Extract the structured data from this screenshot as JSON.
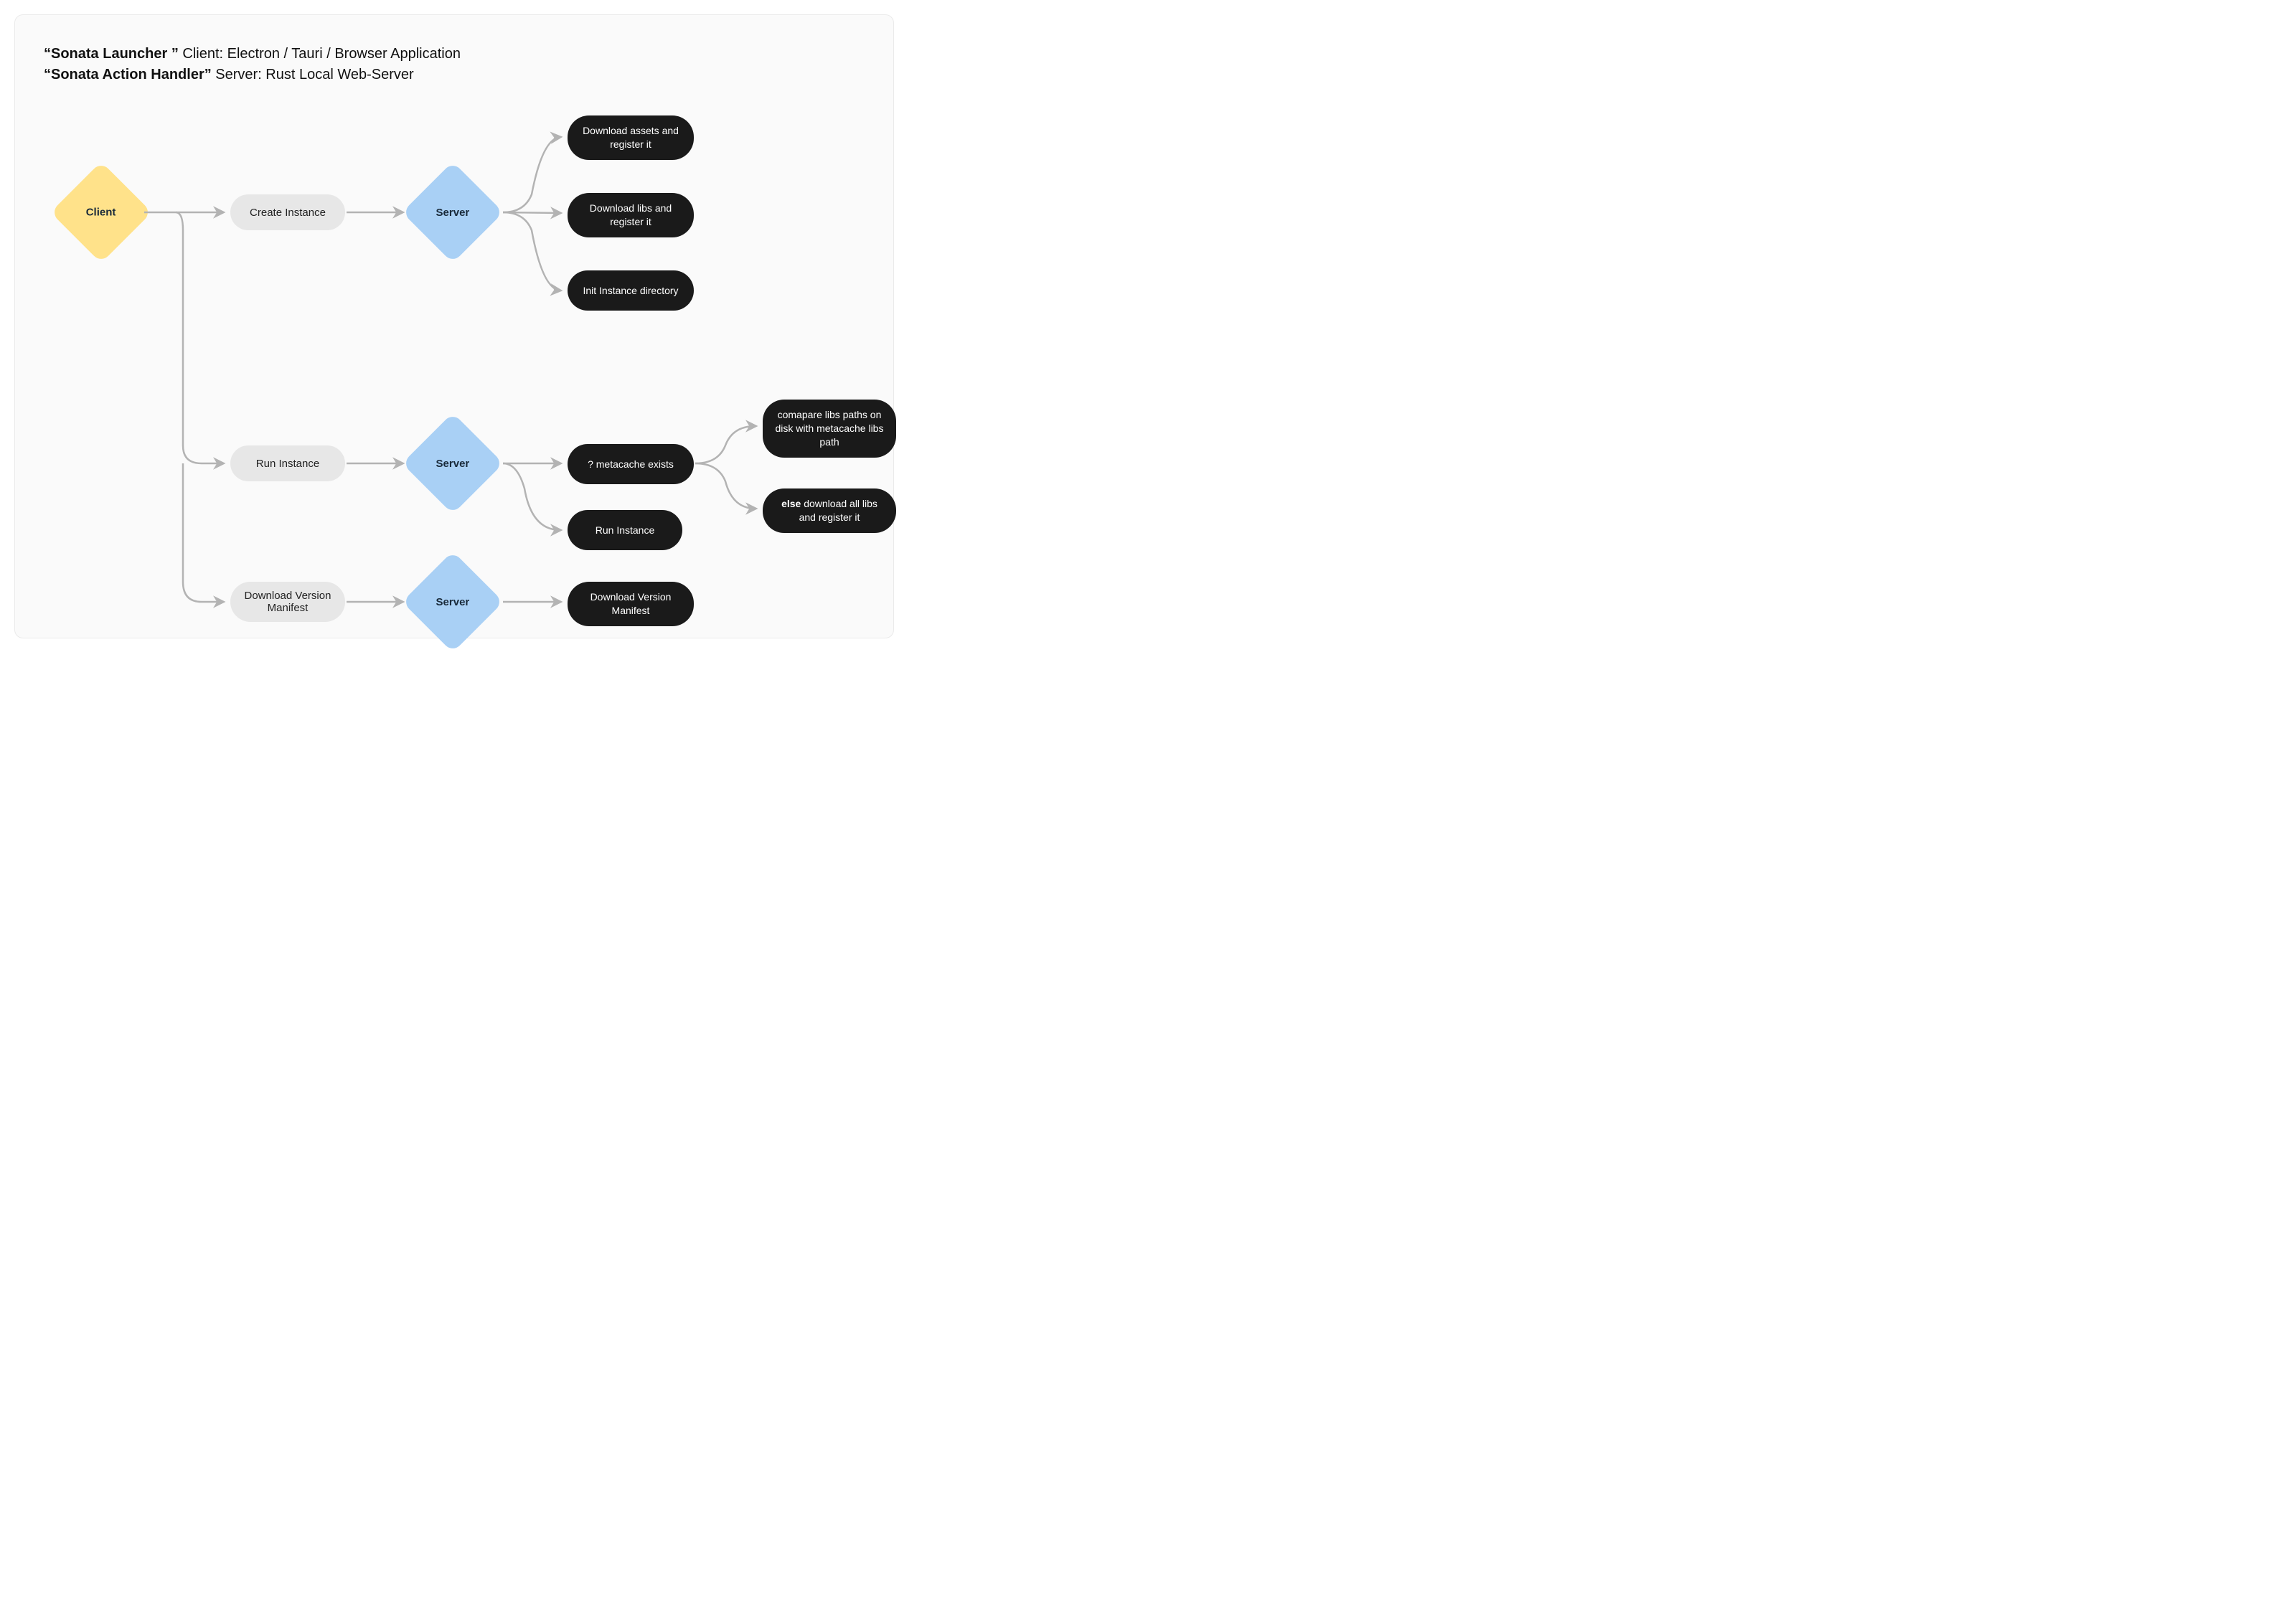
{
  "header": {
    "line1_bold": "“Sonata Launcher ”",
    "line1_rest": " Client: Electron / Tauri / Browser Application",
    "line2_bold": "“Sonata Action Handler”",
    "line2_rest": " Server: Rust Local Web-Server"
  },
  "nodes": {
    "client": "Client",
    "server": "Server",
    "create_instance": "Create Instance",
    "run_instance_btn": "Run Instance",
    "download_manifest_btn": "Download Version Manifest",
    "dl_assets": "Download assets and register it",
    "dl_libs": "Download libs and register it",
    "init_dir": "Init Instance directory",
    "metacache_q": "? metacache exists",
    "run_instance_action": "Run Instance",
    "dl_manifest_action": "Download Version Manifest",
    "compare_libs": "comapare libs paths on disk with metacache libs path",
    "else_label": "else",
    "else_text": " download all libs and register it"
  },
  "colors": {
    "client_diamond": "#ffe28a",
    "server_diamond": "#a9d0f5",
    "pill_grey": "#e7e7e7",
    "pill_dark": "#1a1a1a",
    "arrow": "#b3b3b3",
    "frame_bg": "#fafafa"
  }
}
